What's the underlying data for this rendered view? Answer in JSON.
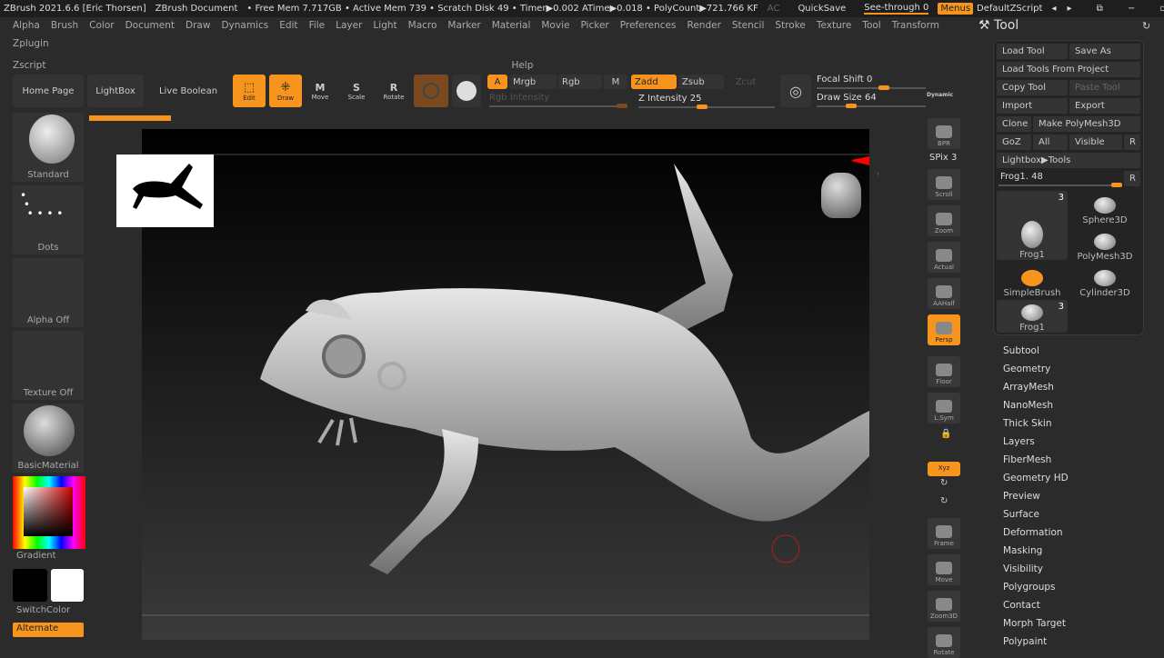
{
  "titlebar": {
    "app": "ZBrush 2021.6.6 [Eric Thorsen]",
    "doc": "ZBrush Document",
    "stats": "• Free Mem 7.717GB • Active Mem 739 • Scratch Disk 49 • Timer▶0.002 ATime▶0.018 • PolyCount▶721.766 KF",
    "ac": "AC",
    "quicksave": "QuickSave",
    "seethrough": "See-through  0",
    "menus": "Menus",
    "script": "DefaultZScript"
  },
  "menu": [
    "Alpha",
    "Brush",
    "Color",
    "Document",
    "Draw",
    "Dynamics",
    "Edit",
    "File",
    "Layer",
    "Light",
    "Macro",
    "Marker",
    "Material",
    "Movie",
    "Picker",
    "Preferences",
    "Render",
    "Stencil",
    "Stroke",
    "Texture",
    "Tool",
    "Transform",
    "Zplugin",
    "Zscript",
    "Help"
  ],
  "top_buttons": {
    "home": "Home Page",
    "lightbox": "LightBox",
    "liveboolean": "Live Boolean"
  },
  "tools": {
    "edit": "Edit",
    "draw": "Draw",
    "move": "Move",
    "scale": "Scale",
    "rotate": "Rotate"
  },
  "modes": {
    "a": "A",
    "mrgb": "Mrgb",
    "rgb": "Rgb",
    "m": "M",
    "zadd": "Zadd",
    "zsub": "Zsub",
    "zcut": "Zcut",
    "rgb_intensity": "Rgb Intensity",
    "z_intensity": "Z Intensity 25",
    "focal_shift": "Focal Shift 0",
    "draw_size": "Draw Size 64",
    "dynamic": "Dynamic"
  },
  "sliders": {
    "z_intensity": 25,
    "draw_size": 64,
    "focal_shift": 0
  },
  "left_shelf": {
    "brush": "Standard",
    "stroke": "Dots",
    "alpha": "Alpha Off",
    "texture": "Texture Off",
    "material": "BasicMaterial",
    "gradient": "Gradient",
    "switchcolor": "SwitchColor",
    "alternate": "Alternate"
  },
  "right_shelf": [
    "BPR",
    "SPix 3",
    "Scroll",
    "Zoom",
    "Actual",
    "AAHalf",
    "Persp",
    "Floor",
    "L.Sym",
    "",
    "Xyz",
    "",
    "",
    "Frame",
    "Move",
    "Zoom3D",
    "Rotate"
  ],
  "tool_panel": {
    "title": "Tool",
    "load_tool": "Load Tool",
    "save_as": "Save As",
    "load_from_project": "Load Tools From Project",
    "copy_tool": "Copy Tool",
    "paste_tool": "Paste Tool",
    "import": "Import",
    "export": "Export",
    "clone": "Clone",
    "make_polymesh": "Make PolyMesh3D",
    "goz": "GoZ",
    "all": "All",
    "visible": "Visible",
    "r": "R",
    "lightbox_tools": "Lightbox▶Tools",
    "frog_slider": "Frog1. 48",
    "thumbs": [
      {
        "label": "Frog1",
        "count": "3"
      },
      {
        "label": "Sphere3D"
      },
      {
        "label": "PolyMesh3D"
      },
      {
        "label": "SimpleBrush"
      },
      {
        "label": "Cylinder3D"
      },
      {
        "label": "Frog1",
        "count": "3"
      }
    ],
    "subpalettes": [
      "Subtool",
      "Geometry",
      "ArrayMesh",
      "NanoMesh",
      "Thick Skin",
      "Layers",
      "FiberMesh",
      "Geometry HD",
      "Preview",
      "Surface",
      "Deformation",
      "Masking",
      "Visibility",
      "Polygroups",
      "Contact",
      "Morph Target",
      "Polypaint"
    ]
  },
  "colors": {
    "accent": "#f7941d"
  }
}
